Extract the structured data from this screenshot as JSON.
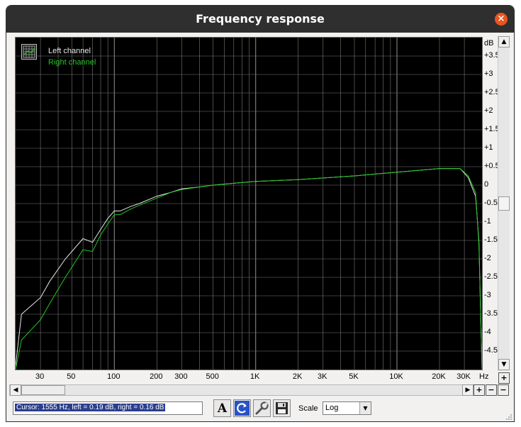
{
  "window": {
    "title": "Frequency response",
    "close_icon": "×"
  },
  "legend": {
    "left_label": "Left channel",
    "right_label": "Right channel"
  },
  "colors": {
    "left": "#e8e8e8",
    "right": "#22c622",
    "background": "#000000",
    "grid": "#7a7a7a",
    "title_bar": "#2f2f2f",
    "close": "#e95420"
  },
  "chart_data": {
    "type": "line",
    "x_scale": "log",
    "xlim": [
      20,
      40000
    ],
    "ylim": [
      -5,
      4
    ],
    "xlabel": "Hz",
    "ylabel": "dB",
    "x_ticks": [
      {
        "value": 30,
        "label": "30"
      },
      {
        "value": 50,
        "label": "50"
      },
      {
        "value": 100,
        "label": "100"
      },
      {
        "value": 200,
        "label": "200"
      },
      {
        "value": 300,
        "label": "300"
      },
      {
        "value": 500,
        "label": "500"
      },
      {
        "value": 1000,
        "label": "1K"
      },
      {
        "value": 2000,
        "label": "2K"
      },
      {
        "value": 3000,
        "label": "3K"
      },
      {
        "value": 5000,
        "label": "5K"
      },
      {
        "value": 10000,
        "label": "10K"
      },
      {
        "value": 20000,
        "label": "20K"
      },
      {
        "value": 30000,
        "label": "30K"
      }
    ],
    "y_ticks": [
      {
        "value": 3.5,
        "label": "+3.5"
      },
      {
        "value": 3,
        "label": "+3"
      },
      {
        "value": 2.5,
        "label": "+2.5"
      },
      {
        "value": 2,
        "label": "+2"
      },
      {
        "value": 1.5,
        "label": "+1.5"
      },
      {
        "value": 1,
        "label": "+1"
      },
      {
        "value": 0.5,
        "label": "+0.5"
      },
      {
        "value": 0,
        "label": "0"
      },
      {
        "value": -0.5,
        "label": "-0.5"
      },
      {
        "value": -1,
        "label": "-1"
      },
      {
        "value": -1.5,
        "label": "-1.5"
      },
      {
        "value": -2,
        "label": "-2"
      },
      {
        "value": -2.5,
        "label": "-2.5"
      },
      {
        "value": -3,
        "label": "-3"
      },
      {
        "value": -3.5,
        "label": "-3.5"
      },
      {
        "value": -4,
        "label": "-4"
      },
      {
        "value": -4.5,
        "label": "-4.5"
      }
    ],
    "series": [
      {
        "name": "Left channel",
        "x": [
          20,
          22,
          30,
          35,
          45,
          60,
          70,
          80,
          90,
          100,
          110,
          130,
          150,
          200,
          250,
          300,
          400,
          500,
          700,
          1000,
          2000,
          5000,
          10000,
          20000,
          28000,
          32000,
          36000,
          38000,
          40000
        ],
        "y": [
          -4.9,
          -3.5,
          -3.05,
          -2.6,
          -2.0,
          -1.45,
          -1.55,
          -1.2,
          -0.9,
          -0.7,
          -0.7,
          -0.58,
          -0.5,
          -0.3,
          -0.2,
          -0.1,
          -0.05,
          0.0,
          0.05,
          0.1,
          0.15,
          0.25,
          0.35,
          0.45,
          0.45,
          0.2,
          -0.3,
          -1.5,
          -5.0
        ]
      },
      {
        "name": "Right channel",
        "x": [
          20,
          22,
          30,
          35,
          45,
          60,
          70,
          80,
          90,
          100,
          110,
          130,
          150,
          200,
          250,
          300,
          400,
          500,
          700,
          1000,
          2000,
          5000,
          10000,
          20000,
          28000,
          32000,
          36000,
          38000,
          40000
        ],
        "y": [
          -5.0,
          -4.2,
          -3.65,
          -3.2,
          -2.5,
          -1.75,
          -1.8,
          -1.35,
          -1.05,
          -0.8,
          -0.8,
          -0.65,
          -0.55,
          -0.35,
          -0.2,
          -0.12,
          -0.05,
          0.0,
          0.05,
          0.1,
          0.15,
          0.25,
          0.35,
          0.45,
          0.45,
          0.25,
          -0.2,
          -1.6,
          -5.0
        ]
      }
    ]
  },
  "axis_labels": {
    "y_unit": "dB",
    "x_unit": "Hz"
  },
  "status": {
    "cursor_text": "Cursor:  1555 Hz,  left = 0.19 dB,  right = 0.16 dB"
  },
  "toolbar": {
    "font_button_glyph": "A",
    "scale_label": "Scale",
    "scale_value": "Log"
  },
  "icons": [
    "legend-grid-icon",
    "font-icon",
    "refresh-icon",
    "wrench-icon",
    "save-icon",
    "zoom-in-icon",
    "zoom-out-icon",
    "scroll-up-icon",
    "scroll-down-icon",
    "scroll-left-icon",
    "scroll-right-icon",
    "dropdown-arrow-icon",
    "resize-grip-icon"
  ]
}
